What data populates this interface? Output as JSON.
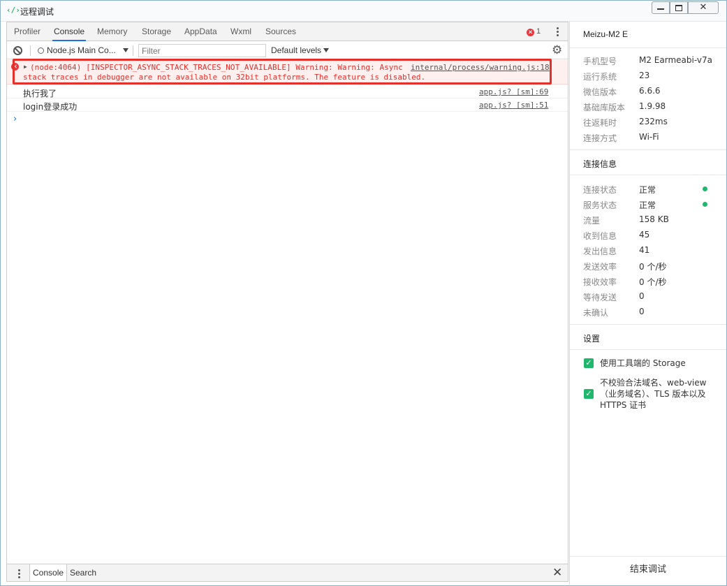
{
  "window": {
    "title": "远程调试",
    "app_icon": "code-brackets-icon"
  },
  "devtools": {
    "tabs": [
      "Profiler",
      "Console",
      "Memory",
      "Storage",
      "AppData",
      "Wxml",
      "Sources"
    ],
    "active_tab": "Console",
    "error_count": "1",
    "toolbar": {
      "context": "Node.js Main Co...",
      "filter_placeholder": "Filter",
      "levels": "Default levels"
    },
    "console": {
      "messages": [
        {
          "level": "error",
          "line1": "(node:4064) [INSPECTOR_ASYNC_STACK_TRACES_NOT_AVAILABLE] Warning: Warning: Async",
          "line2": "stack traces in debugger are not available on 32bit platforms. The feature is disabled.",
          "source": "internal/process/warning.js:18"
        },
        {
          "level": "log",
          "text": "执行我了",
          "source": "app.js? [sm]:69"
        },
        {
          "level": "log",
          "text": "login登录成功",
          "source": "app.js? [sm]:51"
        }
      ],
      "prompt": "›"
    },
    "drawer_tabs": [
      "Console",
      "Search"
    ],
    "drawer_active": "Console"
  },
  "side": {
    "device": "Meizu-M2 E",
    "device_info": [
      {
        "key": "手机型号",
        "value": "M2 Earmeabi-v7a"
      },
      {
        "key": "运行系统",
        "value": "23"
      },
      {
        "key": "微信版本",
        "value": "6.6.6"
      },
      {
        "key": "基础库版本",
        "value": "1.9.98"
      },
      {
        "key": "往返耗时",
        "value": "232ms"
      },
      {
        "key": "连接方式",
        "value": "Wi-Fi"
      }
    ],
    "connection_title": "连接信息",
    "connection_info": [
      {
        "key": "连接状态",
        "value": "正常",
        "status": "ok"
      },
      {
        "key": "服务状态",
        "value": "正常",
        "status": "ok"
      },
      {
        "key": "流量",
        "value": "158 KB"
      },
      {
        "key": "收到信息",
        "value": "45"
      },
      {
        "key": "发出信息",
        "value": "41"
      },
      {
        "key": "发送效率",
        "value": "0 个/秒"
      },
      {
        "key": "接收效率",
        "value": "0 个/秒"
      },
      {
        "key": "等待发送",
        "value": "0"
      },
      {
        "key": "未确认",
        "value": "0"
      }
    ],
    "settings_title": "设置",
    "settings": [
      {
        "label": "使用工具端的 Storage",
        "checked": true
      },
      {
        "label": "不校验合法域名、web-view（业务域名）、TLS 版本以及 HTTPS 证书",
        "checked": true
      }
    ],
    "end_button": "结束调试"
  },
  "colors": {
    "accent_green": "#1fb76b",
    "error_red": "#e4302b",
    "tab_active": "#1a73e8"
  }
}
